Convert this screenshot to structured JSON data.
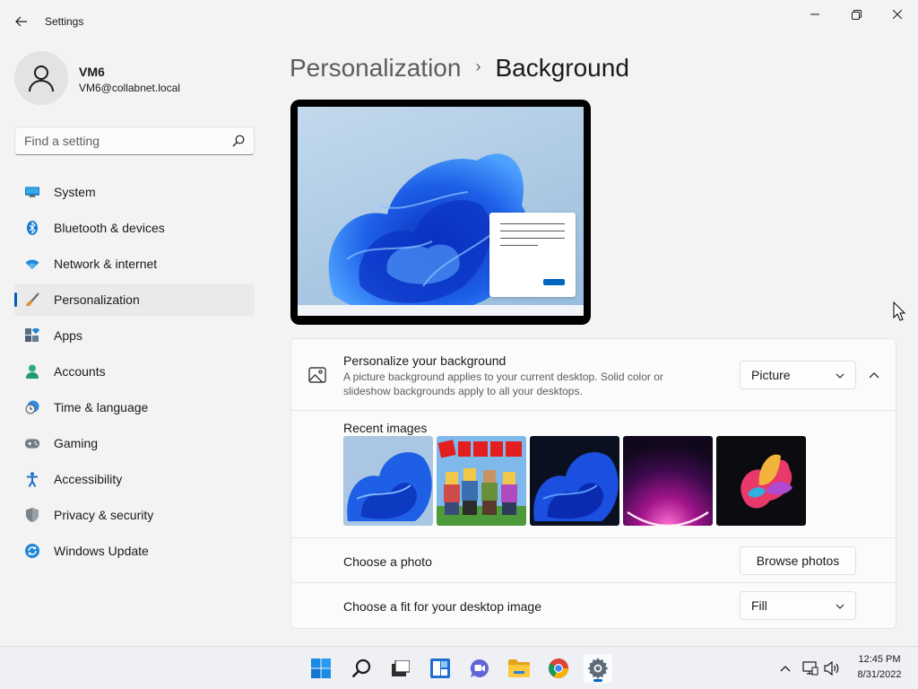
{
  "window": {
    "title": "Settings"
  },
  "user": {
    "name": "VM6",
    "email": "VM6@collabnet.local"
  },
  "search": {
    "placeholder": "Find a setting"
  },
  "nav": {
    "items": [
      {
        "label": "System",
        "icon": "monitor-icon"
      },
      {
        "label": "Bluetooth & devices",
        "icon": "bluetooth-icon"
      },
      {
        "label": "Network & internet",
        "icon": "wifi-icon"
      },
      {
        "label": "Personalization",
        "icon": "brush-icon",
        "selected": true
      },
      {
        "label": "Apps",
        "icon": "apps-icon"
      },
      {
        "label": "Accounts",
        "icon": "person-icon"
      },
      {
        "label": "Time & language",
        "icon": "clock-globe-icon"
      },
      {
        "label": "Gaming",
        "icon": "gamepad-icon"
      },
      {
        "label": "Accessibility",
        "icon": "accessibility-icon"
      },
      {
        "label": "Privacy & security",
        "icon": "shield-icon"
      },
      {
        "label": "Windows Update",
        "icon": "update-icon"
      }
    ]
  },
  "breadcrumb": {
    "parent": "Personalization",
    "separator": "›",
    "current": "Background"
  },
  "background": {
    "title": "Personalize your background",
    "description": "A picture background applies to your current desktop. Solid color or slideshow backgrounds apply to all your desktops.",
    "type_value": "Picture",
    "recent_label": "Recent images",
    "recent_images": [
      "windows-11-bloom-light",
      "roblox-characters",
      "windows-11-bloom-dark",
      "purple-glow-arc",
      "colorful-abstract-flower"
    ],
    "choose_photo_label": "Choose a photo",
    "browse_label": "Browse photos",
    "fit_label": "Choose a fit for your desktop image",
    "fit_value": "Fill"
  },
  "taskbar": {
    "apps": [
      "start-icon",
      "search-icon",
      "task-view-icon",
      "widgets-icon",
      "chat-icon",
      "file-explorer-icon",
      "chrome-icon",
      "settings-icon"
    ],
    "time": "12:45 PM",
    "date": "8/31/2022"
  },
  "colors": {
    "accent": "#005fb8",
    "background": "#f3f3f3",
    "card": "#fbfbfb"
  }
}
